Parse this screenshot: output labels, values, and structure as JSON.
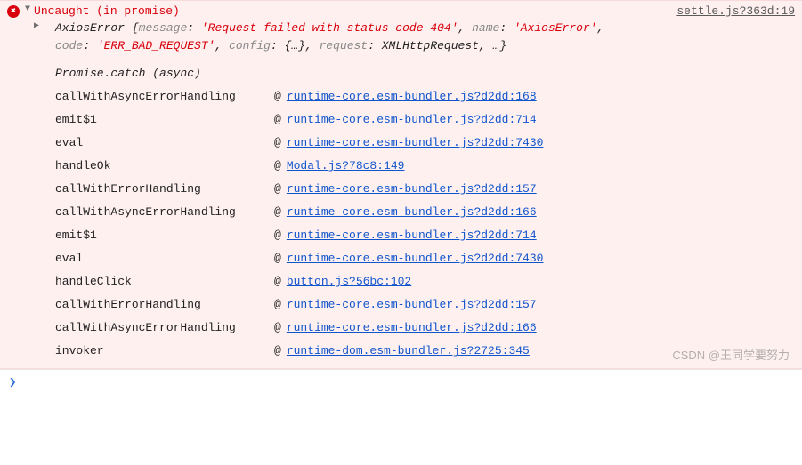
{
  "error": {
    "label": "Uncaught (in promise)",
    "source": "settle.js?363d:19",
    "object_name": "AxiosError",
    "props": {
      "message_key": "message",
      "message_val": "'Request failed with status code 404'",
      "name_key": "name",
      "name_val": "'AxiosError'",
      "code_key": "code",
      "code_val": "'ERR_BAD_REQUEST'",
      "config_key": "config",
      "config_val": "{…}",
      "request_key": "request",
      "request_val": "XMLHttpRequest",
      "rest": ", …"
    }
  },
  "async_header": "Promise.catch (async)",
  "stack": [
    {
      "fn": "callWithAsyncErrorHandling",
      "link": "runtime-core.esm-bundler.js?d2dd:168"
    },
    {
      "fn": "emit$1",
      "link": "runtime-core.esm-bundler.js?d2dd:714"
    },
    {
      "fn": "eval",
      "link": "runtime-core.esm-bundler.js?d2dd:7430"
    },
    {
      "fn": "handleOk",
      "link": "Modal.js?78c8:149"
    },
    {
      "fn": "callWithErrorHandling",
      "link": "runtime-core.esm-bundler.js?d2dd:157"
    },
    {
      "fn": "callWithAsyncErrorHandling",
      "link": "runtime-core.esm-bundler.js?d2dd:166"
    },
    {
      "fn": "emit$1",
      "link": "runtime-core.esm-bundler.js?d2dd:714"
    },
    {
      "fn": "eval",
      "link": "runtime-core.esm-bundler.js?d2dd:7430"
    },
    {
      "fn": "handleClick",
      "link": "button.js?56bc:102"
    },
    {
      "fn": "callWithErrorHandling",
      "link": "runtime-core.esm-bundler.js?d2dd:157"
    },
    {
      "fn": "callWithAsyncErrorHandling",
      "link": "runtime-core.esm-bundler.js?d2dd:166"
    },
    {
      "fn": "invoker",
      "link": "runtime-dom.esm-bundler.js?2725:345"
    }
  ],
  "prompt": "❯",
  "watermark": "CSDN @王同学要努力"
}
